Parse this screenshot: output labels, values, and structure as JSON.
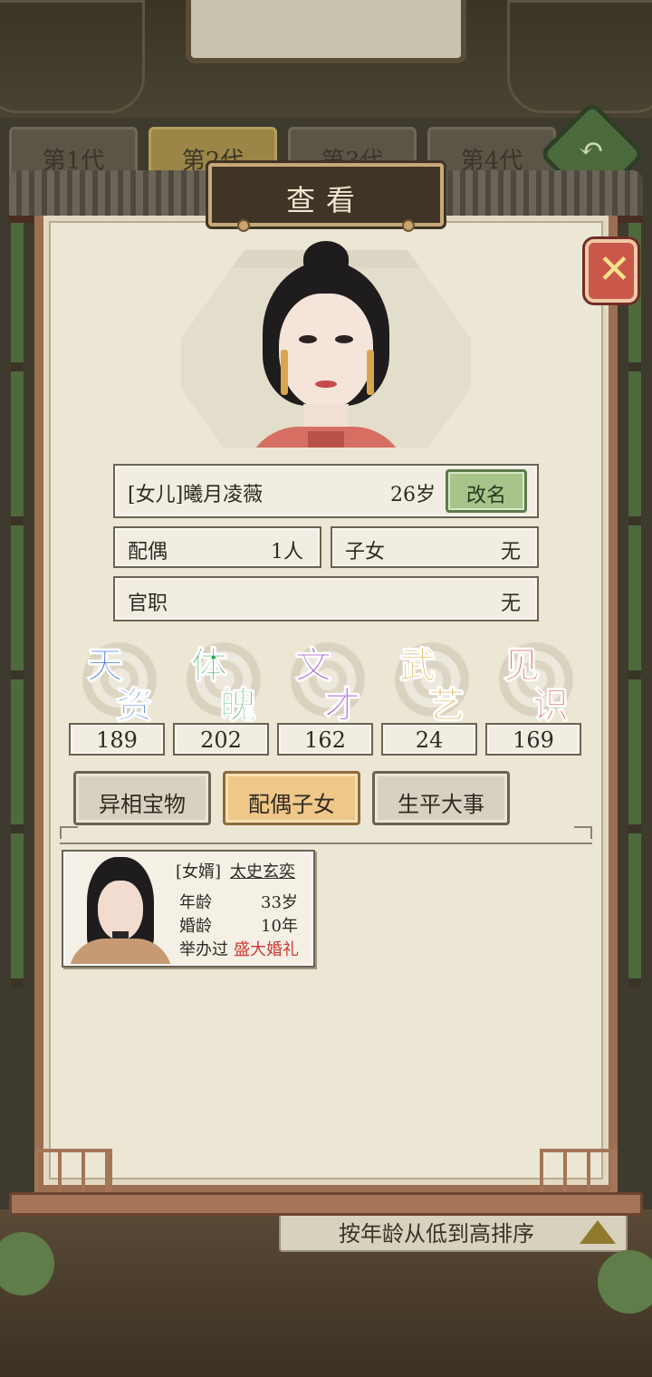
{
  "background": {
    "generation_tabs": [
      "第1代",
      "第2代",
      "第3代",
      "第4代"
    ],
    "active_generation_index": 1,
    "sort_label": "按年龄从低到高排序"
  },
  "dialog": {
    "title": "查看",
    "close_icon": "close-icon"
  },
  "person": {
    "relation_name": "[女儿]曦月凌薇",
    "age": "26岁",
    "rename_label": "改名",
    "spouse_label": "配偶",
    "spouse_value": "1人",
    "children_label": "子女",
    "children_value": "无",
    "office_label": "官职",
    "office_value": "无"
  },
  "stats": [
    {
      "c1": "天",
      "c2": "资",
      "value": "189",
      "color": "#3a6fe0"
    },
    {
      "c1": "体",
      "c2": "魄",
      "value": "202",
      "color": "#2fa45a"
    },
    {
      "c1": "文",
      "c2": "才",
      "value": "162",
      "color": "#9a3fc9"
    },
    {
      "c1": "武",
      "c2": "艺",
      "value": "24",
      "color": "#e0a12a"
    },
    {
      "c1": "见",
      "c2": "识",
      "value": "169",
      "color": "#d9533f"
    }
  ],
  "tabs": [
    {
      "label": "异相宝物",
      "active": false
    },
    {
      "label": "配偶子女",
      "active": true
    },
    {
      "label": "生平大事",
      "active": false
    }
  ],
  "spouse_card": {
    "relation": "[女婿]",
    "name": "太史玄奕",
    "age_label": "年龄",
    "age_value": "33岁",
    "marriage_label": "婚龄",
    "marriage_value": "10年",
    "wedding_prefix": "举办过",
    "wedding_type": "盛大婚礼"
  }
}
